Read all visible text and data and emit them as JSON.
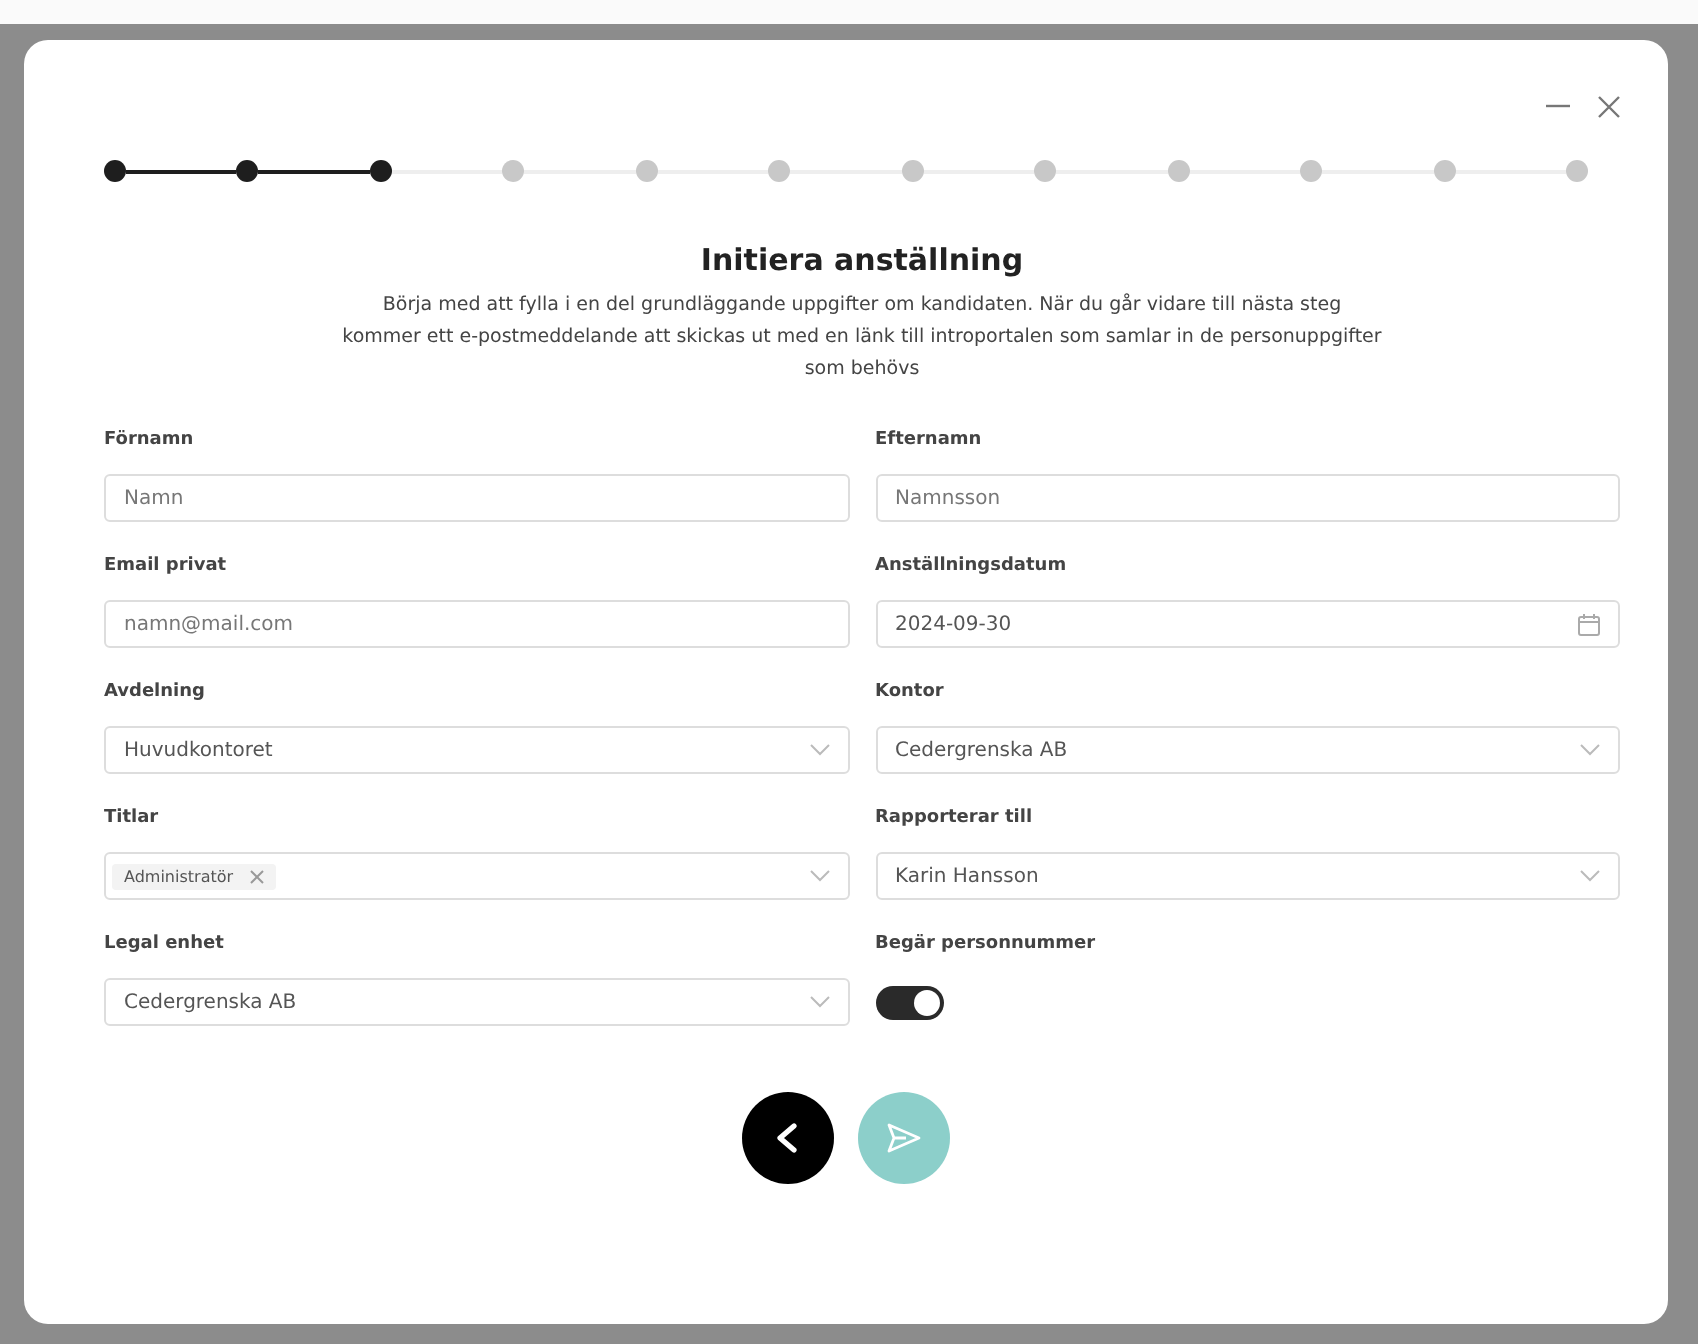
{
  "steps": [
    {
      "done": true
    },
    {
      "done": true
    },
    {
      "done": true
    },
    {
      "done": false
    },
    {
      "done": false
    },
    {
      "done": false
    },
    {
      "done": false
    },
    {
      "done": false
    },
    {
      "done": false
    },
    {
      "done": false
    },
    {
      "done": false
    },
    {
      "done": false
    }
  ],
  "title": "Initiera anställning",
  "intro": "Börja med att fylla i en del grundläggande uppgifter om kandidaten. När du går vidare till nästa steg kommer ett e-postmeddelande att skickas ut med en länk till introportalen som samlar in de personuppgifter som behövs",
  "fields": [
    {
      "kind": "text",
      "label": "Förnamn",
      "placeholder": "Namn"
    },
    {
      "kind": "text",
      "label": "Efternamn",
      "placeholder": "Namnsson"
    },
    {
      "kind": "text",
      "label": "Email privat",
      "placeholder": "namn@mail.com"
    },
    {
      "kind": "date",
      "label": "Anställningsdatum",
      "value": "2024-09-30"
    },
    {
      "kind": "select",
      "label": "Avdelning",
      "value": "Huvudkontoret"
    },
    {
      "kind": "select",
      "label": "Kontor",
      "value": "Cedergrenska AB"
    },
    {
      "kind": "tags",
      "label": "Titlar",
      "tags": [
        "Administratör"
      ]
    },
    {
      "kind": "select",
      "label": "Rapporterar till",
      "value": "Karin Hansson"
    },
    {
      "kind": "select",
      "label": "Legal enhet",
      "value": "Cedergrenska AB"
    },
    {
      "kind": "toggle",
      "label": "Begär personnummer",
      "on": true
    }
  ],
  "next_enabled": false
}
